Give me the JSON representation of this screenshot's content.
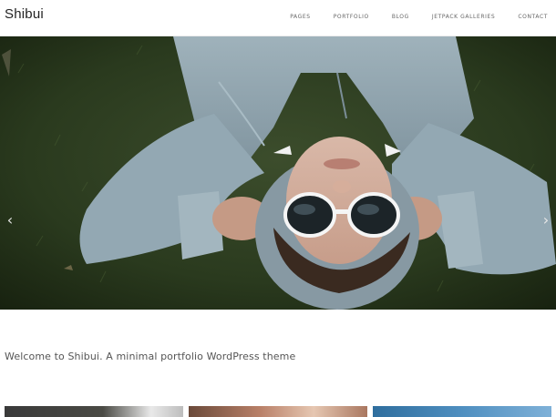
{
  "site": {
    "title": "Shibui"
  },
  "nav": {
    "items": [
      {
        "label": "PAGES"
      },
      {
        "label": "PORTFOLIO"
      },
      {
        "label": "BLOG"
      },
      {
        "label": "JETPACK GALLERIES"
      },
      {
        "label": "CONTACT"
      }
    ]
  },
  "slider": {
    "prev_icon": "chevron-left-icon",
    "next_icon": "chevron-right-icon",
    "prev_glyph": "‹",
    "next_glyph": "›"
  },
  "intro": {
    "text": "Welcome to Shibui. A minimal portfolio WordPress theme"
  },
  "colors": {
    "background": "#ffffff",
    "grass": "#2b3b1f",
    "hoodie": "#8fa3ad",
    "text": "#555555"
  }
}
